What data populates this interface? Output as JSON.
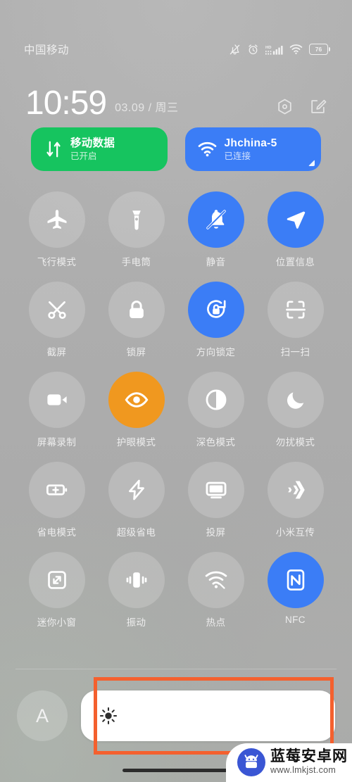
{
  "status_bar": {
    "carrier": "中国移动",
    "battery_percent": "76",
    "icons": [
      "bell-muted-icon",
      "alarm-clock-icon",
      "hd-signal-icon",
      "wifi-icon",
      "battery-icon"
    ]
  },
  "header": {
    "time": "10:59",
    "date": "03.09 / 周三",
    "settings_icon": "hex-settings-icon",
    "edit_icon": "edit-icon"
  },
  "big_tiles": [
    {
      "title": "移动数据",
      "subtitle": "已开启",
      "icon": "mobile-data-icon",
      "color": "#16c45f",
      "state": "on"
    },
    {
      "title": "Jhchina-5",
      "subtitle": "已连接",
      "icon": "wifi-icon",
      "color": "#3b7df6",
      "state": "on"
    }
  ],
  "quick_settings": [
    {
      "label": "飞行模式",
      "icon": "airplane-icon",
      "state": "off"
    },
    {
      "label": "手电筒",
      "icon": "flashlight-icon",
      "state": "off"
    },
    {
      "label": "静音",
      "icon": "bell-muted-icon",
      "state": "on-blue"
    },
    {
      "label": "位置信息",
      "icon": "location-arrow-icon",
      "state": "on-blue"
    },
    {
      "label": "截屏",
      "icon": "screenshot-icon",
      "state": "off"
    },
    {
      "label": "锁屏",
      "icon": "lock-icon",
      "state": "off"
    },
    {
      "label": "方向锁定",
      "icon": "rotation-lock-icon",
      "state": "on-blue"
    },
    {
      "label": "扫一扫",
      "icon": "scan-icon",
      "state": "off"
    },
    {
      "label": "屏幕录制",
      "icon": "camcorder-icon",
      "state": "off"
    },
    {
      "label": "护眼模式",
      "icon": "eye-icon",
      "state": "on-orange"
    },
    {
      "label": "深色模式",
      "icon": "contrast-icon",
      "state": "off"
    },
    {
      "label": "勿扰模式",
      "icon": "moon-icon",
      "state": "off"
    },
    {
      "label": "省电模式",
      "icon": "battery-plus-icon",
      "state": "off"
    },
    {
      "label": "超级省电",
      "icon": "lightning-icon",
      "state": "off"
    },
    {
      "label": "投屏",
      "icon": "monitor-icon",
      "state": "off"
    },
    {
      "label": "小米互传",
      "icon": "mi-share-icon",
      "state": "off"
    },
    {
      "label": "迷你小窗",
      "icon": "mini-window-icon",
      "state": "off"
    },
    {
      "label": "振动",
      "icon": "vibrate-icon",
      "state": "off"
    },
    {
      "label": "热点",
      "icon": "hotspot-icon",
      "state": "off"
    },
    {
      "label": "NFC",
      "icon": "nfc-icon",
      "state": "on-blue"
    }
  ],
  "brightness": {
    "auto_label": "A",
    "auto_icon": "auto-brightness-icon",
    "slider_icon": "sun-icon",
    "slider_fill_percent": "100"
  },
  "annotation": {
    "color": "#f4602e",
    "target": "brightness-slider"
  },
  "watermark": {
    "site_name": "蓝莓安卓网",
    "url": "www.lmkjst.com",
    "logo": "android-robot-icon"
  },
  "colors": {
    "accent_blue": "#3b7df6",
    "accent_green": "#16c45f",
    "accent_orange": "#f0981f",
    "annotation_orange": "#f4602e",
    "background_gray": "#ababab"
  }
}
